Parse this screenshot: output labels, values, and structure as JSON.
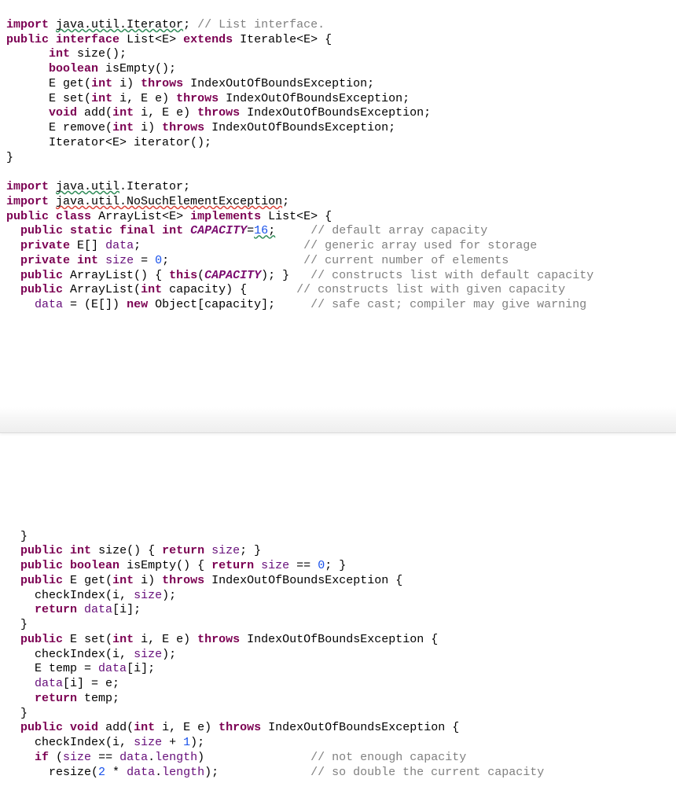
{
  "block1": {
    "l1_import": "import",
    "l1_pkg": "java.util.Iterator",
    "l1_semi": ";",
    "l1_comment": "// List interface.",
    "l2_public": "public",
    "l2_interface": "interface",
    "l2_name": "List<E>",
    "l2_extends": "extends",
    "l2_iter": "Iterable<E> {",
    "l3_int": "int",
    "l3_size": "size();",
    "l4_bool": "boolean",
    "l4_isEmpty": "isEmpty();",
    "l5_e": "E",
    "l5_get": "get(",
    "l5_int": "int",
    "l5_i": " i)",
    "l5_throws": "throws",
    "l5_exc": "IndexOutOfBoundsException;",
    "l6_e": "E",
    "l6_set": "set(",
    "l6_int": "int",
    "l6_i": " i, E e)",
    "l6_throws": "throws",
    "l6_exc": "IndexOutOfBoundsException;",
    "l7_void": "void",
    "l7_add": "add(",
    "l7_int": "int",
    "l7_i": " i, E e)",
    "l7_throws": "throws",
    "l7_exc": "IndexOutOfBoundsException;",
    "l8_e": "E",
    "l8_rem": "remove(",
    "l8_int": "int",
    "l8_i": " i)",
    "l8_throws": "throws",
    "l8_exc": "IndexOutOfBoundsException;",
    "l9_iter": "Iterator<E> iterator();",
    "l10_close": "}",
    "l12_import": "import",
    "l12_pkg": "java.util",
    "l12_rest": ".Iterator;",
    "l13_import": "import",
    "l13_pkg": "java.util.NoSuchElementException",
    "l13_semi": ";",
    "l14_public": "public",
    "l14_class": "class",
    "l14_name": "ArrayList<E>",
    "l14_impl": "implements",
    "l14_list": "List<E> {",
    "l15_pub": "public",
    "l15_static": "static",
    "l15_final": "final",
    "l15_int": "int",
    "l15_cap": "CAPACITY",
    "l15_eq": "=",
    "l15_val": "16",
    "l15_semi": ";",
    "l15_c": "// default array capacity",
    "l16_priv": "private",
    "l16_e": "E[]",
    "l16_data": "data",
    "l16_semi": ";",
    "l16_c": "// generic array used for storage",
    "l17_priv": "private",
    "l17_int": "int",
    "l17_size": "size",
    "l17_eq": " = ",
    "l17_zero": "0",
    "l17_semi": ";",
    "l17_c": "// current number of elements",
    "l18_pub": "public",
    "l18_al": "ArrayList() {",
    "l18_this": "this",
    "l18_p1": "(",
    "l18_cap": "CAPACITY",
    "l18_p2": "); }",
    "l18_c": "// constructs list with default capacity",
    "l19_pub": "public",
    "l19_al": "ArrayList(",
    "l19_int": "int",
    "l19_cap": " capacity) {",
    "l19_c": "// constructs list with given capacity",
    "l20_data": "data",
    "l20_eq": " = (E[])",
    "l20_new": "new",
    "l20_obj": " Object[capacity];",
    "l20_c": "// safe cast; compiler may give warning"
  },
  "block2": {
    "l1_close": "}",
    "l2_pub": "public",
    "l2_int": "int",
    "l2_size": "size() {",
    "l2_ret": "return",
    "l2_sz": "size",
    "l2_end": "; }",
    "l3_pub": "public",
    "l3_bool": "boolean",
    "l3_is": "isEmpty() {",
    "l3_ret": "return",
    "l3_sz": "size",
    "l3_eq": " == ",
    "l3_zero": "0",
    "l3_end": "; }",
    "l4_pub": "public",
    "l4_e": "E",
    "l4_get": "get(",
    "l4_int": "int",
    "l4_i": " i)",
    "l4_thr": "throws",
    "l4_exc": "IndexOutOfBoundsException {",
    "l5_ci": "checkIndex(i,",
    "l5_sz": "size",
    "l5_end": ");",
    "l6_ret": "return",
    "l6_data": "data",
    "l6_i": "[i];",
    "l7_close": "}",
    "l8_pub": "public",
    "l8_e": "E",
    "l8_set": "set(",
    "l8_int": "int",
    "l8_i": " i, E e)",
    "l8_thr": "throws",
    "l8_exc": "IndexOutOfBoundsException {",
    "l9_ci": "checkIndex(i,",
    "l9_sz": "size",
    "l9_end": ");",
    "l10_e": "E temp =",
    "l10_data": "data",
    "l10_i": "[i];",
    "l11_data": "data",
    "l11_i": "[i] = e;",
    "l12_ret": "return",
    "l12_temp": " temp;",
    "l13_close": "}",
    "l14_pub": "public",
    "l14_void": "void",
    "l14_add": "add(",
    "l14_int": "int",
    "l14_i": " i, E e)",
    "l14_thr": "throws",
    "l14_exc": "IndexOutOfBoundsException {",
    "l15_ci": "checkIndex(i,",
    "l15_sz": "size",
    "l15_plus": " + ",
    "l15_one": "1",
    "l15_end": ");",
    "l16_if": "if",
    "l16_p": " (",
    "l16_sz": "size",
    "l16_eq": " == ",
    "l16_data": "data",
    "l16_len": ".",
    "l16_length": "length",
    "l16_end": ")",
    "l16_c": "// not enough capacity",
    "l17_res": "resize(",
    "l17_two": "2",
    "l17_star": " * ",
    "l17_data": "data",
    "l17_dot": ".",
    "l17_length": "length",
    "l17_end": ");",
    "l17_c": "// so double the current capacity"
  }
}
